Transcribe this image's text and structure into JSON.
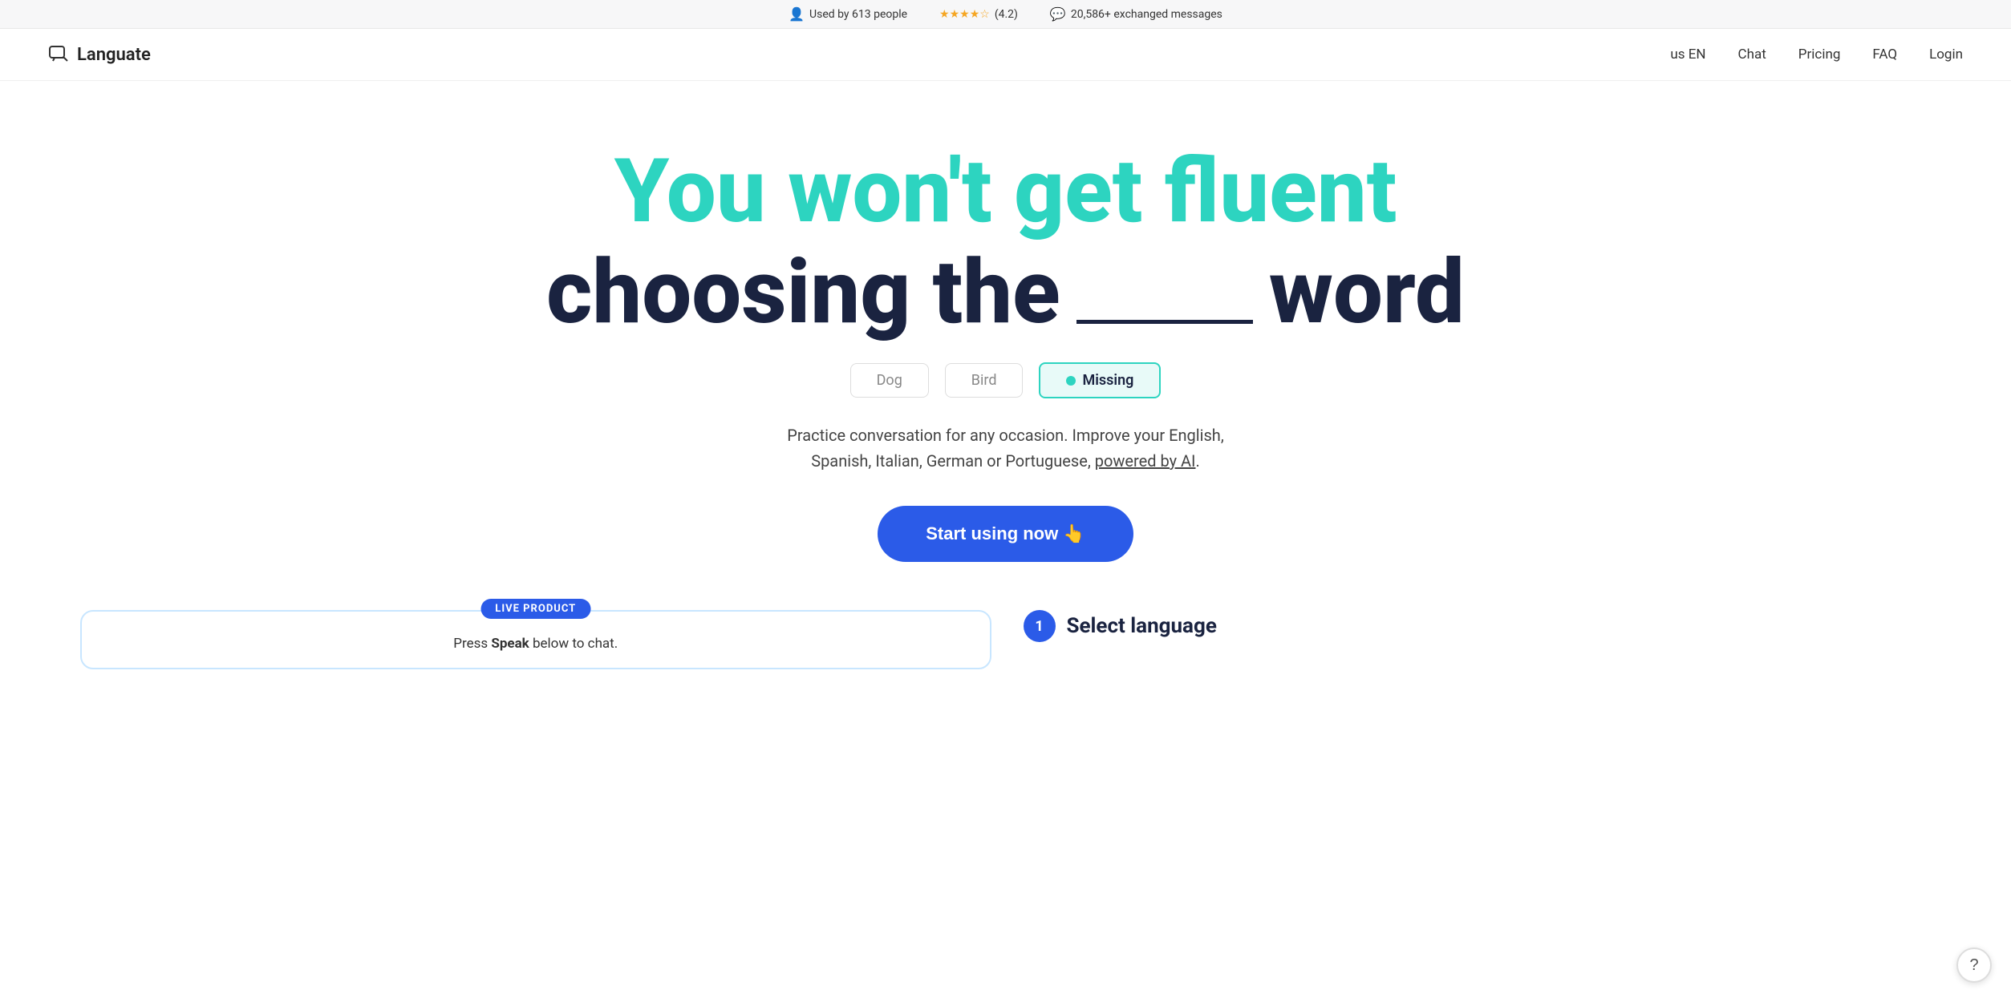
{
  "top_banner": {
    "users_label": "Used by 613 people",
    "rating_label": "(4.2)",
    "messages_label": "20,586+ exchanged messages",
    "stars": "★★★★☆"
  },
  "nav": {
    "logo_text": "Languate",
    "links": [
      {
        "label": "us EN",
        "id": "lang-switcher"
      },
      {
        "label": "Chat",
        "id": "chat-link"
      },
      {
        "label": "Pricing",
        "id": "pricing-link"
      },
      {
        "label": "FAQ",
        "id": "faq-link"
      },
      {
        "label": "Login",
        "id": "login-link"
      }
    ]
  },
  "hero": {
    "headline_line1_teal": "You won't get fluent",
    "headline_line2_part1": "choosing the",
    "headline_line2_blank": "",
    "headline_line2_part2": "word",
    "choices": [
      {
        "label": "Dog",
        "selected": false
      },
      {
        "label": "Bird",
        "selected": false
      },
      {
        "label": "Missing",
        "selected": true
      }
    ],
    "subtitle": "Practice conversation for any occasion. Improve your English, Spanish, Italian, German or Portuguese,",
    "subtitle_link": "powered by AI",
    "subtitle_end": ".",
    "cta_label": "Start using now 👆"
  },
  "live_product": {
    "badge": "LIVE PRODUCT",
    "speak_text": "Press",
    "speak_bold": "Speak",
    "speak_text2": "below to chat."
  },
  "select_language": {
    "step_number": "1",
    "title": "Select language"
  },
  "help": {
    "icon": "?"
  }
}
